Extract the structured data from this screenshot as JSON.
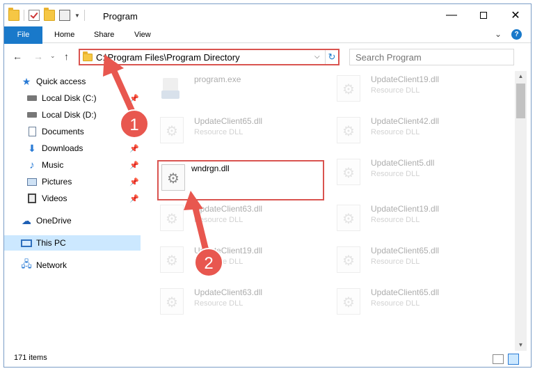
{
  "window": {
    "title": "Program",
    "minimize": "—",
    "maximize": "",
    "close": "✕"
  },
  "ribbon": {
    "tabs": [
      "File",
      "Home",
      "Share",
      "View"
    ],
    "collapse": "⌄",
    "help": "?"
  },
  "address": {
    "path": "C:\\Program Files\\Program Directory",
    "dropdown": "⌵",
    "refresh": "↻"
  },
  "search": {
    "placeholder": "Search Program"
  },
  "nav": {
    "back": "←",
    "forward": "→",
    "recent": "⌄",
    "up": "↑"
  },
  "sidebar": {
    "items": [
      {
        "label": "Quick access",
        "icon": "star-icon",
        "pinned": false
      },
      {
        "label": "Local Disk (C:)",
        "icon": "drive-icon",
        "pinned": true
      },
      {
        "label": "Local Disk (D:)",
        "icon": "drive-icon",
        "pinned": false
      },
      {
        "label": "Documents",
        "icon": "document-icon",
        "pinned": true
      },
      {
        "label": "Downloads",
        "icon": "download-icon",
        "pinned": true
      },
      {
        "label": "Music",
        "icon": "music-icon",
        "pinned": true
      },
      {
        "label": "Pictures",
        "icon": "picture-icon",
        "pinned": true
      },
      {
        "label": "Videos",
        "icon": "video-icon",
        "pinned": true
      },
      {
        "label": "OneDrive",
        "icon": "cloud-icon",
        "pinned": false
      },
      {
        "label": "This PC",
        "icon": "pc-icon",
        "pinned": false,
        "selected": true
      },
      {
        "label": "Network",
        "icon": "network-icon",
        "pinned": false
      }
    ]
  },
  "files": [
    {
      "name": "program.exe",
      "type": "",
      "kind": "exe"
    },
    {
      "name": "UpdateClient19.dll",
      "type": "Resource DLL"
    },
    {
      "name": "UpdateClient65.dll",
      "type": "Resource DLL"
    },
    {
      "name": "UpdateClient42.dll",
      "type": "Resource DLL"
    },
    {
      "name": "wndrgn.dll",
      "type": "",
      "highlight": true
    },
    {
      "name": "UpdateClient5.dll",
      "type": "Resource DLL"
    },
    {
      "name": "UpdateClient63.dll",
      "type": "Resource DLL"
    },
    {
      "name": "UpdateClient19.dll",
      "type": "Resource DLL"
    },
    {
      "name": "UpdateClient19.dll",
      "type": "Resource DLL"
    },
    {
      "name": "UpdateClient65.dll",
      "type": "Resource DLL"
    },
    {
      "name": "UpdateClient63.dll",
      "type": "Resource DLL"
    },
    {
      "name": "UpdateClient65.dll",
      "type": "Resource DLL"
    }
  ],
  "status": {
    "count": "171 items"
  },
  "annotations": {
    "step1": "1",
    "step2": "2",
    "color": "#e8574f"
  },
  "colors": {
    "accent": "#1979ca",
    "highlight_border": "#d9534f",
    "selected_bg": "#cce8ff"
  }
}
